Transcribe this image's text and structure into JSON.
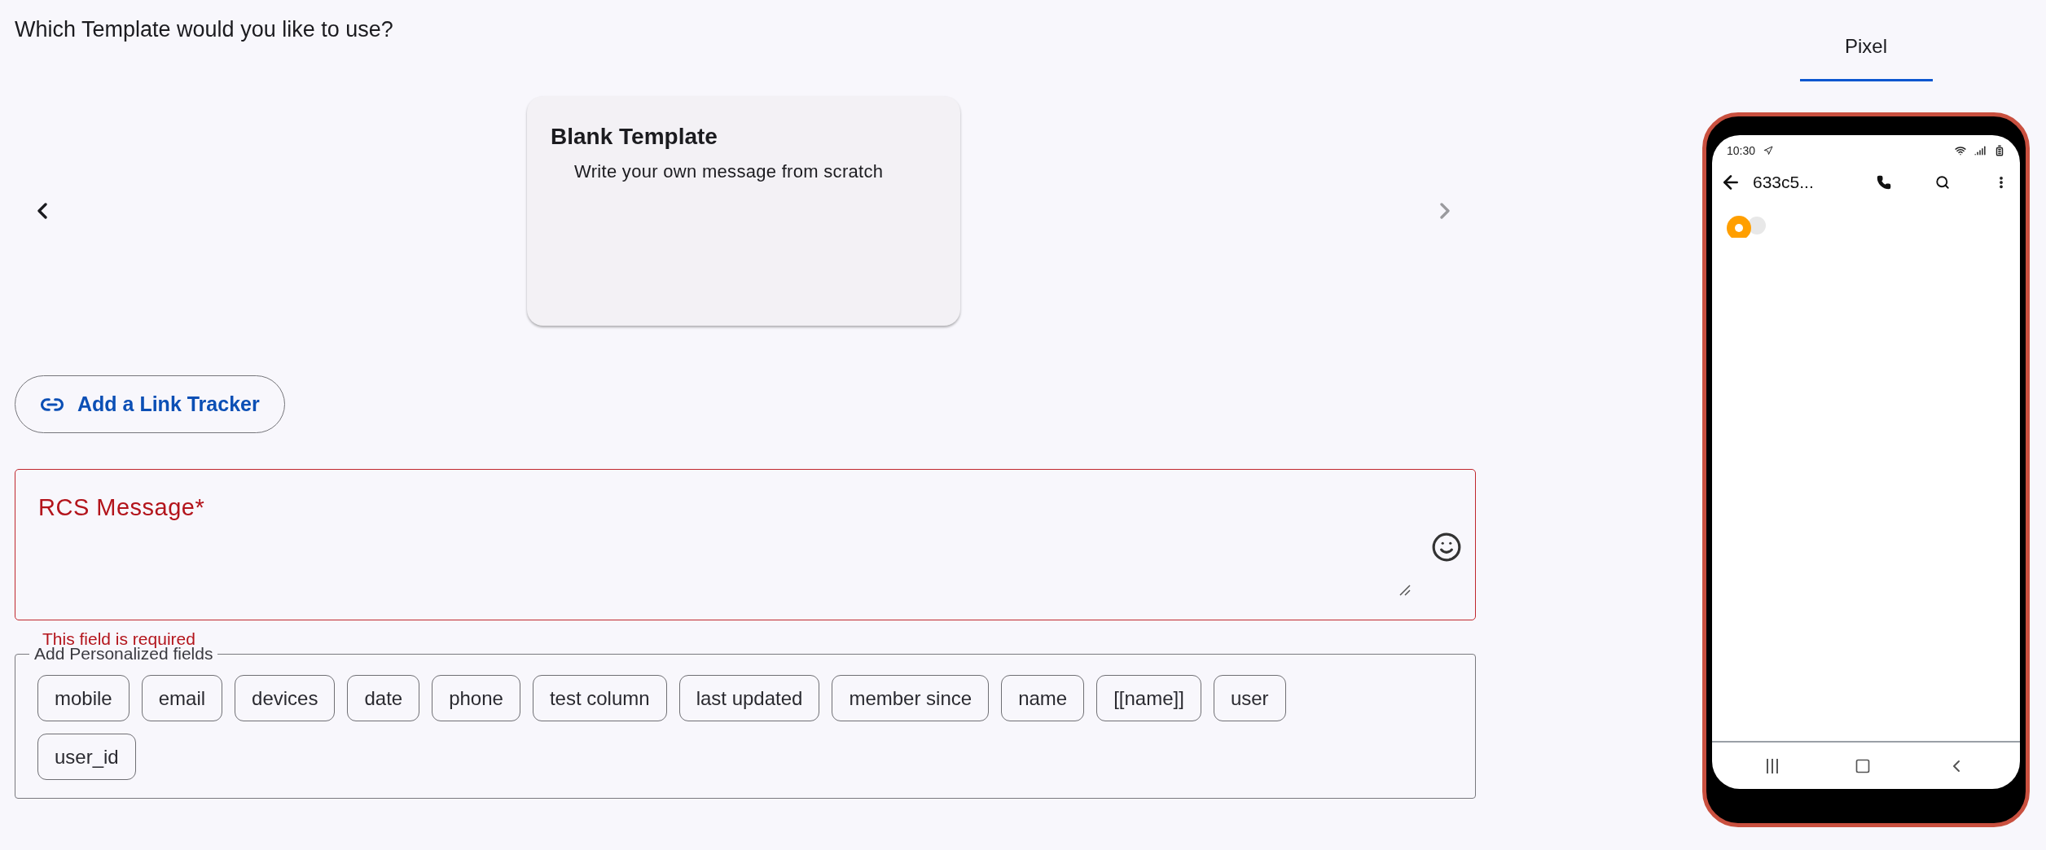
{
  "header": {
    "title": "Which Template would you like to use?"
  },
  "carousel": {
    "prev": {
      "disabled": false
    },
    "next": {
      "disabled": true
    },
    "cards": [
      {
        "title": "Blank Template",
        "description": "Write your own message from scratch"
      }
    ]
  },
  "link_tracker": {
    "label": "Add a Link Tracker"
  },
  "message_field": {
    "label": "RCS Message*",
    "error": true,
    "helper_text": "This field is required"
  },
  "personalized_fields": {
    "legend": "Add Personalized fields",
    "chips": [
      "mobile",
      "email",
      "devices",
      "date",
      "phone",
      "test column",
      "last updated",
      "member since",
      "name",
      "[[name]]",
      "user",
      "user_id"
    ]
  },
  "preview": {
    "tabs": [
      {
        "label": "Pixel",
        "selected": true
      }
    ],
    "phone": {
      "time": "10:30",
      "contact": "633c5..."
    }
  }
}
